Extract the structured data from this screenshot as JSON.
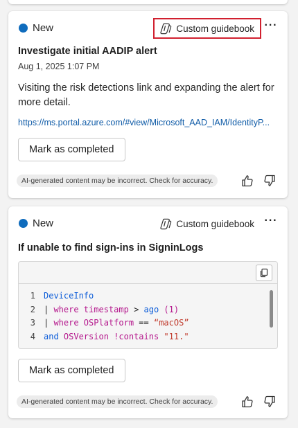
{
  "cards": [
    {
      "status": "New",
      "guidebook_label": "Custom guidebook",
      "more_label": "···",
      "title": "Investigate initial AADIP alert",
      "timestamp": "Aug 1, 2025 1:07 PM",
      "body": "Visiting the risk detections link and expanding the alert for more detail.",
      "link": "https://ms.portal.azure.com/#view/Microsoft_AAD_IAM/IdentityP...",
      "button_label": "Mark as completed",
      "disclaimer": "AI-generated content may be incorrect. Check for accuracy."
    },
    {
      "status": "New",
      "guidebook_label": "Custom guidebook",
      "more_label": "···",
      "title": "If unable to find sign-ins in SigninLogs",
      "code": [
        {
          "n": "1",
          "tokens": [
            {
              "t": "DeviceInfo",
              "c": "#0a5bd8"
            }
          ]
        },
        {
          "n": "2",
          "tokens": [
            {
              "t": "| ",
              "c": "#242424"
            },
            {
              "t": "where",
              "c": "#b4168c"
            },
            {
              "t": " timestamp ",
              "c": "#b4168c"
            },
            {
              "t": "> ",
              "c": "#242424"
            },
            {
              "t": "ago",
              "c": "#0a5bd8"
            },
            {
              "t": " (1)",
              "c": "#b4168c"
            }
          ]
        },
        {
          "n": "3",
          "tokens": [
            {
              "t": "| ",
              "c": "#242424"
            },
            {
              "t": "where",
              "c": "#b4168c"
            },
            {
              "t": " OSPlatform ",
              "c": "#b4168c"
            },
            {
              "t": "== ",
              "c": "#242424"
            },
            {
              "t": "“macOS”",
              "c": "#c0392b"
            }
          ]
        },
        {
          "n": "4",
          "tokens": [
            {
              "t": "and",
              "c": "#0a5bd8"
            },
            {
              "t": " OSVersion ",
              "c": "#b4168c"
            },
            {
              "t": "!contains ",
              "c": "#b4168c"
            },
            {
              "t": "\"11.\"",
              "c": "#c0392b"
            }
          ]
        }
      ],
      "button_label": "Mark as completed",
      "disclaimer": "AI-generated content may be incorrect. Check for accuracy."
    }
  ],
  "colors": {
    "status_dot": "#0f6cbd",
    "highlight_border": "#d1202f",
    "link": "#0f5ba7"
  },
  "icons": [
    "copilot-guidebook-icon",
    "more-icon",
    "thumbs-up-icon",
    "thumbs-down-icon",
    "copy-icon"
  ]
}
